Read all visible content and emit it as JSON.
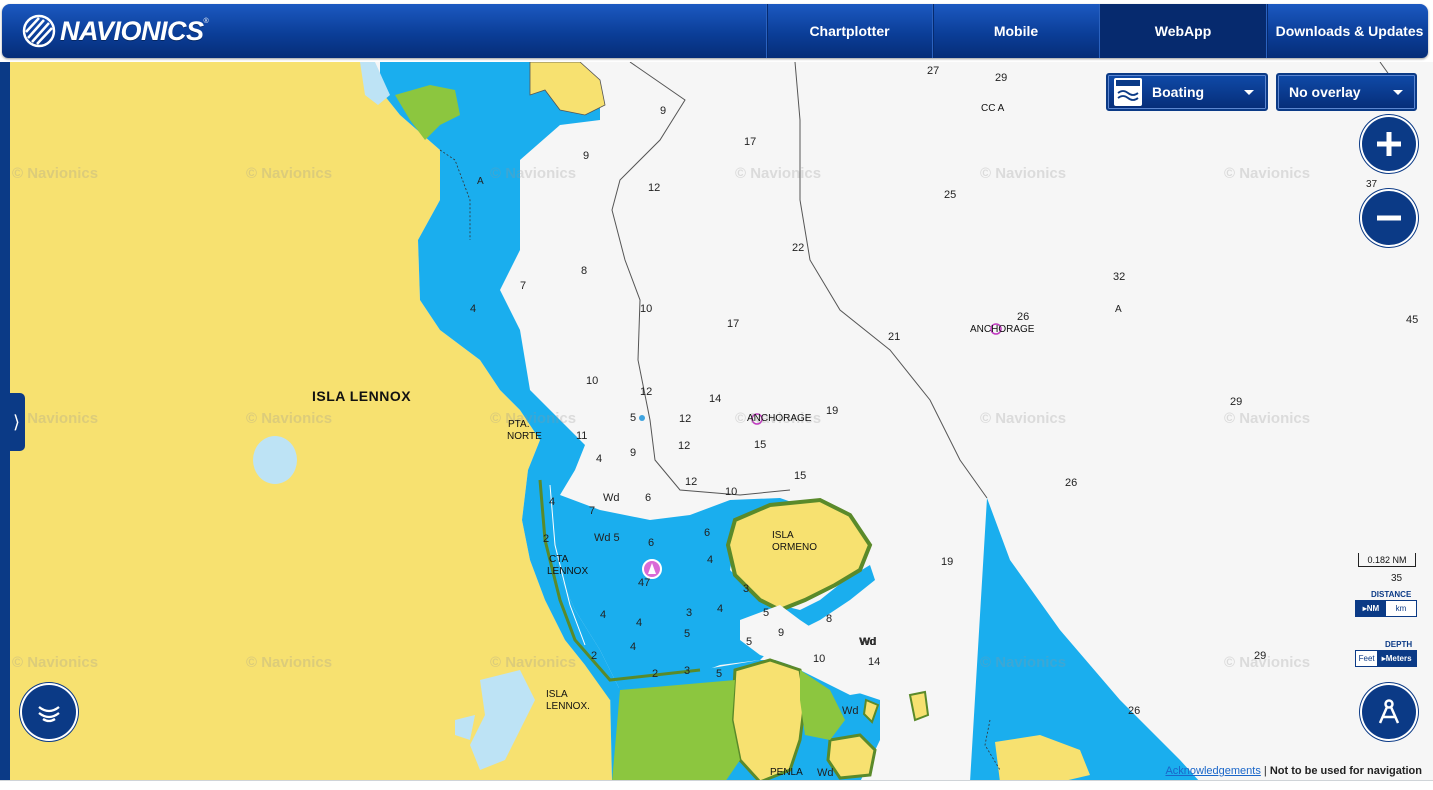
{
  "header": {
    "logo_text": "NAVIONICS",
    "nav": [
      {
        "label": "Chartplotter",
        "active": false
      },
      {
        "label": "Mobile",
        "active": false
      },
      {
        "label": "WebApp",
        "active": true
      },
      {
        "label": "Downloads & Updates",
        "active": false
      }
    ]
  },
  "controls": {
    "mode_dropdown": "Boating",
    "overlay_dropdown": "No overlay",
    "zoom_in": "+",
    "zoom_out": "−",
    "scale_label": "0.182 NM",
    "distance_label": "DISTANCE",
    "distance_options": [
      "NM",
      "km"
    ],
    "distance_selected": "NM",
    "depth_label": "DEPTH",
    "depth_options": [
      "Feet",
      "Meters"
    ],
    "depth_selected": "Meters"
  },
  "map": {
    "watermark": "© Navionics",
    "places": {
      "isla_lennox": "ISLA LENNOX",
      "pta_norte_1": "PTA.",
      "pta_norte_2": "NORTE",
      "cta_lennox_1": "CTA",
      "cta_lennox_2": "LENNOX",
      "isla_ormeno_1": "ISLA",
      "isla_ormeno_2": "ORMENO",
      "isla_lennox_s1": "ISLA",
      "isla_lennox_s2": "LENNOX.",
      "penla": "PENLA",
      "anchorage_1": "ANCHORAGE",
      "anchorage_2": "ANCHORAGE",
      "cc_a": "CC A"
    },
    "soundings": [
      "27",
      "29",
      "9",
      "17",
      "9",
      "12",
      "25",
      "37",
      "22",
      "8",
      "7",
      "32",
      "10",
      "17",
      "21",
      "26",
      "45",
      "4",
      "A",
      "10",
      "12",
      "14",
      "19",
      "11",
      "5",
      "12",
      "12",
      "15",
      "29",
      "4",
      "9",
      "15",
      "26",
      "12",
      "10",
      "Wd",
      "6",
      "7",
      "4",
      "2",
      "Wd 5",
      "6",
      "6",
      "4",
      "19",
      "47",
      "3",
      "5",
      "4",
      "3",
      "4",
      "8",
      "9",
      "Wd",
      "35",
      "4",
      "4",
      "5",
      "5",
      "10",
      "14",
      "29",
      "2",
      "3",
      "2",
      "5",
      "26",
      "Wd",
      "Wd",
      "Wd",
      "A"
    ]
  },
  "footer": {
    "ack_link": "Acknowledgements",
    "separator": "|",
    "disclaimer": "Not to be used for navigation"
  }
}
